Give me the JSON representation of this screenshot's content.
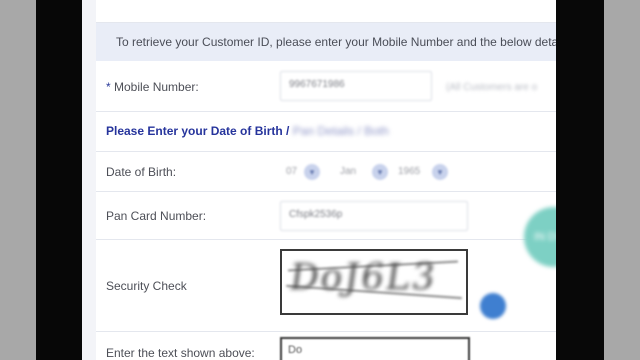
{
  "info_text": "To retrieve your Customer ID, please enter your Mobile Number and the below deta",
  "mobile": {
    "required_mark": "*",
    "label": "Mobile Number:",
    "value": "9967671986",
    "help": "(All Customers are o"
  },
  "section": {
    "heading": "Please Enter your Date of Birth / ",
    "heading_blurred": "Pan Details / Both"
  },
  "dob": {
    "label": "Date of Birth:",
    "day": "07",
    "month": "Jan",
    "year": "1965"
  },
  "pan": {
    "label": "Pan Card Number:",
    "value": "Cfspk2536p"
  },
  "security": {
    "label": "Security Check",
    "captcha_text": "DoJ6L3"
  },
  "captcha_input": {
    "label": "Enter the text shown above:",
    "value": "Do"
  },
  "floating_badge": "IN DI"
}
